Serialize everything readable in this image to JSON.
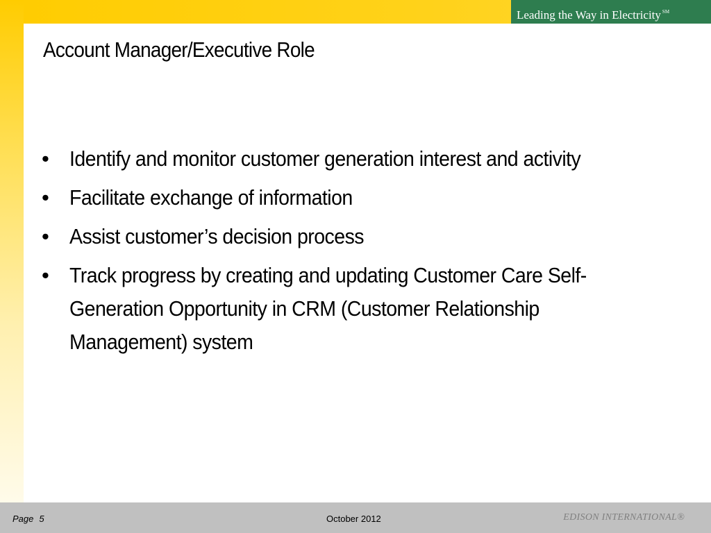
{
  "header": {
    "tagline": "Leading the Way in Electricity",
    "tagline_mark": "SM"
  },
  "slide": {
    "title": "Account Manager/Executive Role",
    "bullet_char": "•",
    "bullets": [
      "Identify and monitor customer generation interest and activity",
      "Facilitate exchange of information",
      "Assist customer’s decision process",
      "Track progress by creating and updating Customer Care Self-Generation Opportunity in CRM (Customer Relationship Management) system"
    ]
  },
  "footer": {
    "page_label": "Page",
    "page_number": "5",
    "date": "October 2012",
    "brand": "EDISON INTERNATIONAL®"
  },
  "colors": {
    "band_yellow": "#ffcc00",
    "tagline_green": "#2e7d4f",
    "footer_gray": "#c0c0c0"
  }
}
